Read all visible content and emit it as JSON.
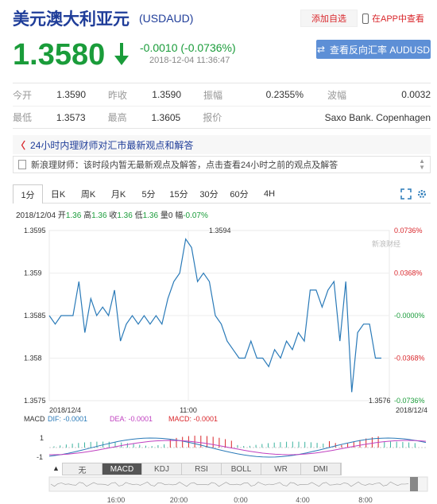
{
  "header": {
    "title": "美元澳大利亚元",
    "code": "(USDAUD)",
    "fav": "添加自选",
    "app": "在APP中查看"
  },
  "quote": {
    "price": "1.3580",
    "change": "-0.0010 (-0.0736%)",
    "time": "2018-12-04 11:36:47",
    "reverse": "查看反向汇率 AUDUSD"
  },
  "stats": [
    [
      {
        "label": "今开",
        "value": "1.3590"
      },
      {
        "label": "昨收",
        "value": "1.3590"
      },
      {
        "label": "振幅",
        "value": "0.2355%"
      },
      {
        "label": "波幅",
        "value": "0.0032"
      }
    ],
    [
      {
        "label": "最低",
        "value": "1.3573"
      },
      {
        "label": "最高",
        "value": "1.3605"
      },
      {
        "label": "报价",
        "value": "Saxo Bank. Copenhagen"
      },
      {
        "label": "",
        "value": ""
      }
    ]
  ],
  "news": {
    "title": "24小时内理财师对汇市最新观点和解答",
    "body": "新浪理财师：该时段内暂无最新观点及解答，点击查看24小时之前的观点及解答"
  },
  "tabs": [
    "1分",
    "日K",
    "周K",
    "月K",
    "5分",
    "15分",
    "30分",
    "60分",
    "4H"
  ],
  "ohlc": {
    "date": "2018/12/04",
    "open_label": "开",
    "open": "1.36",
    "high_label": "高",
    "high": "1.36",
    "close_label": "收",
    "close": "1.36",
    "low_label": "低",
    "low": "1.36",
    "vol_label": "量",
    "vol": "0",
    "amp_label": "幅",
    "amp": "-0.07%"
  },
  "watermark": "新浪财经",
  "macd": {
    "label": "MACD",
    "dif": "DIF: -0.0001",
    "dea": "DEA: -0.0001",
    "macd": "MACD: -0.0001",
    "tick_1": "1",
    "tick_m1": "-1"
  },
  "bottom_tabs": [
    "无",
    "MACD",
    "KDJ",
    "RSI",
    "BOLL",
    "WR",
    "DMI"
  ],
  "timeline_ticks": [
    "16:00",
    "20:00",
    "0:00",
    "4:00",
    "8:00"
  ],
  "colors": {
    "line": "#2a7ab8",
    "green": "#1a9c3a",
    "red": "#d9262b",
    "blue_btn": "#5d8fd6"
  },
  "chart_data": {
    "type": "line",
    "y_left_ticks": [
      "1.3595",
      "1.359",
      "1.3585",
      "1.358",
      "1.3575"
    ],
    "y_right_ticks": [
      "0.0736%",
      "0.0368%",
      "-0.0000%",
      "-0.0368%",
      "-0.0736%"
    ],
    "x_ticks": [
      "2018/12/4",
      "11:00",
      "2018/12/4"
    ],
    "max_label": "1.3594",
    "min_label": "1.3576",
    "ylim": [
      1.3575,
      1.3595
    ],
    "values": [
      1.3585,
      1.3584,
      1.3585,
      1.3585,
      1.3585,
      1.3589,
      1.3583,
      1.3587,
      1.3585,
      1.3586,
      1.3585,
      1.3588,
      1.3582,
      1.3584,
      1.3585,
      1.3584,
      1.3585,
      1.3584,
      1.3585,
      1.3584,
      1.3587,
      1.3589,
      1.359,
      1.3594,
      1.3593,
      1.3589,
      1.359,
      1.3589,
      1.3585,
      1.3584,
      1.3582,
      1.3581,
      1.358,
      1.358,
      1.3582,
      1.358,
      1.358,
      1.3579,
      1.3581,
      1.358,
      1.3582,
      1.3581,
      1.3583,
      1.3582,
      1.3588,
      1.3588,
      1.3586,
      1.3588,
      1.3589,
      1.3582,
      1.3589,
      1.3576,
      1.3583,
      1.3584,
      1.3584,
      1.358,
      1.358
    ]
  }
}
